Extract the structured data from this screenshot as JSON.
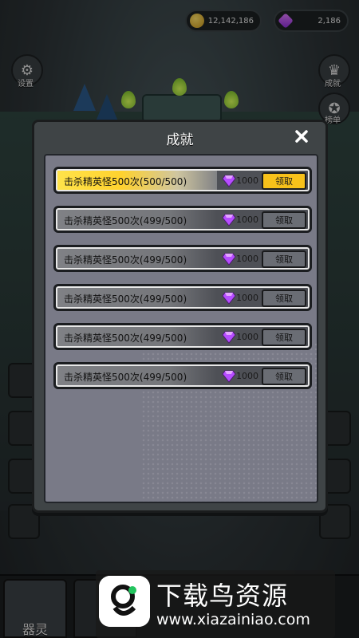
{
  "hud": {
    "gold_value": "12,142,186",
    "gem_value": "2,186"
  },
  "left_buttons": {
    "settings_label": "设置"
  },
  "right_buttons": {
    "achievement_label": "成就",
    "ranking_label": "榜单"
  },
  "modal": {
    "title": "成就",
    "close_glyph": "✕",
    "rows": [
      {
        "text": "击杀精英怪500次(500/500)",
        "reward": "1000",
        "claim": "领取",
        "progress": 1.0,
        "completed": true
      },
      {
        "text": "击杀精英怪500次(499/500)",
        "reward": "1000",
        "claim": "领取",
        "progress": 0.998,
        "completed": false
      },
      {
        "text": "击杀精英怪500次(499/500)",
        "reward": "1000",
        "claim": "领取",
        "progress": 0.998,
        "completed": false
      },
      {
        "text": "击杀精英怪500次(499/500)",
        "reward": "1000",
        "claim": "领取",
        "progress": 0.998,
        "completed": false
      },
      {
        "text": "击杀精英怪500次(499/500)",
        "reward": "1000",
        "claim": "领取",
        "progress": 0.998,
        "completed": false
      },
      {
        "text": "击杀精英怪500次(499/500)",
        "reward": "1000",
        "claim": "领取",
        "progress": 0.998,
        "completed": false
      }
    ]
  },
  "bottom_nav": {
    "tab1_label": "器灵"
  },
  "watermark": {
    "title": "下载鸟资源",
    "url": "www.xiazainiao.com"
  },
  "colors": {
    "claim_active": "#f7c11a",
    "claim_inactive": "#6a6d74",
    "gem": "#b64dff"
  }
}
